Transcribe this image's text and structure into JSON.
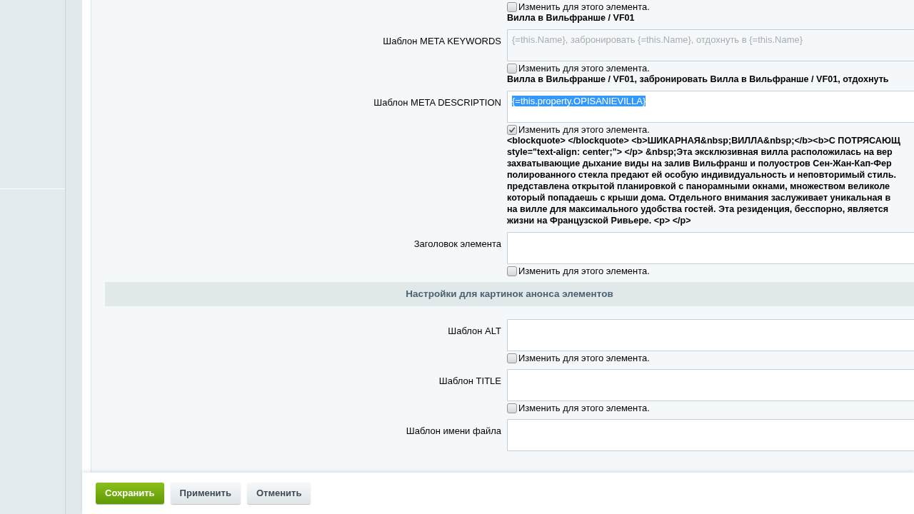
{
  "form": {
    "items": [
      {
        "kind": "tail",
        "override": {
          "label": "Изменить для этого элемента.",
          "checked": false
        },
        "result_lines": [
          "Вилла в Вильфранше / VF01"
        ]
      },
      {
        "kind": "field",
        "label": "Шаблон META KEYWORDS",
        "placeholder": "{=this.Name}, забронировать {=this.Name}, отдохнуть в {=this.Name}",
        "override": {
          "label": "Изменить для этого элемента.",
          "checked": false
        },
        "result_lines": [
          "Вилла в Вильфранше / VF01, забронировать Вилла в Вильфранше / VF01, отдохнуть"
        ]
      },
      {
        "kind": "field",
        "label": "Шаблон META DESCRIPTION",
        "value": "{=this.property.OPISANIEVILLA}",
        "value_selected": true,
        "override": {
          "label": "Изменить для этого элемента.",
          "checked": true
        },
        "result_lines": [
          "<blockquote> </blockquote> <b>ШИКАРНАЯ&nbsp;ВИЛЛА&nbsp;</b><b>С ПОТРЯСАЮЩ",
          "style=\"text-align: center;\"> </p> &nbsp;Эта эксклюзивная вилла расположилась на вер",
          "захватывающие дыхание виды на залив Вильфранш и полуостров Сен-Жан-Кап-Фер",
          "полированного стекла предают ей особую индивидуальность и неповторимый стиль.",
          "представлена открытой планировкой с панорамными окнами, множеством великоле",
          "который попадаешь с крыши дома. Отдельного внимания заслуживает уникальная в",
          "на вилле для максимального удобства гостей. Эта резиденция, бесспорно, является",
          "жизни на Французской Ривьере. <p> </p>"
        ]
      },
      {
        "kind": "field",
        "label": "Заголовок элемента",
        "override": {
          "label": "Изменить для этого элемента.",
          "checked": false
        }
      },
      {
        "kind": "section",
        "label": "Настройки для картинок анонса элементов"
      },
      {
        "kind": "field",
        "label": "Шаблон ALT",
        "override": {
          "label": "Изменить для этого элемента.",
          "checked": false
        }
      },
      {
        "kind": "field",
        "label": "Шаблон TITLE",
        "override": {
          "label": "Изменить для этого элемента.",
          "checked": false
        }
      },
      {
        "kind": "field",
        "label": "Шаблон имени файла"
      }
    ]
  },
  "buttons": [
    {
      "label": "Сохранить",
      "kind": "primary"
    },
    {
      "label": "Применить",
      "kind": "secondary"
    },
    {
      "label": "Отменить",
      "kind": "secondary"
    }
  ]
}
